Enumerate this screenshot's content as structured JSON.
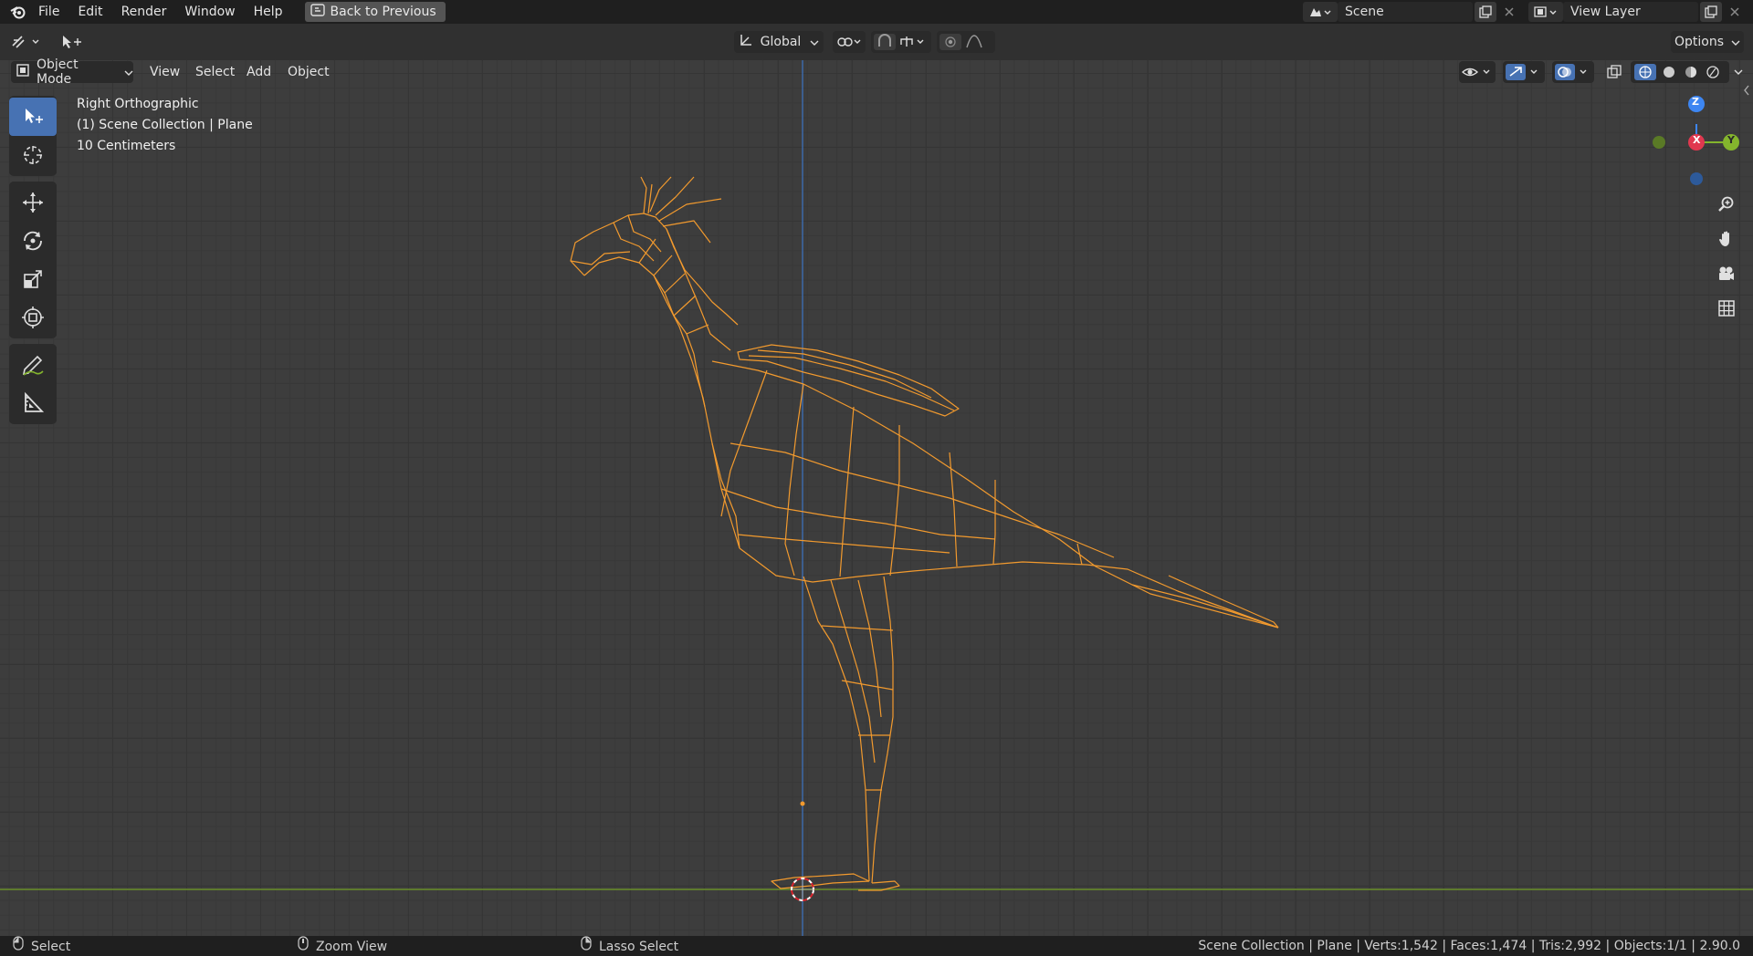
{
  "menu": {
    "items": [
      "File",
      "Edit",
      "Render",
      "Window",
      "Help"
    ],
    "back_button": "Back to Previous"
  },
  "scene": {
    "name": "Scene",
    "view_layer": "View Layer"
  },
  "toolheader": {
    "transform_orientation": "Global",
    "options_label": "Options"
  },
  "viewport_header": {
    "mode": "Object Mode",
    "menus": [
      "View",
      "Select",
      "Add",
      "Object"
    ]
  },
  "overlay": {
    "view_name": "Right Orthographic",
    "collection": "(1) Scene Collection | Plane",
    "scale": "10 Centimeters"
  },
  "gizmo": {
    "z": "Z",
    "x": "X",
    "y": "Y"
  },
  "statusbar": {
    "left_action": "Select",
    "middle_action": "Zoom View",
    "right_action": "Lasso Select",
    "stats": "Scene Collection | Plane | Verts:1,542 | Faces:1,474 | Tris:2,992 | Objects:1/1 | 2.90.0"
  },
  "colors": {
    "selection": "#f29a2e",
    "accent": "#4772b3",
    "axis_x": "#e0384f",
    "axis_y": "#84b52d",
    "axis_z": "#3d86f2"
  },
  "toolbar_icons": [
    "tweak-icon",
    "cursor-icon",
    "move-icon",
    "rotate-icon",
    "scale-icon",
    "transform-icon",
    "annotate-icon",
    "measure-icon"
  ],
  "nav_icons": [
    "zoom-icon",
    "pan-hand-icon",
    "camera-icon",
    "grid-icon"
  ]
}
